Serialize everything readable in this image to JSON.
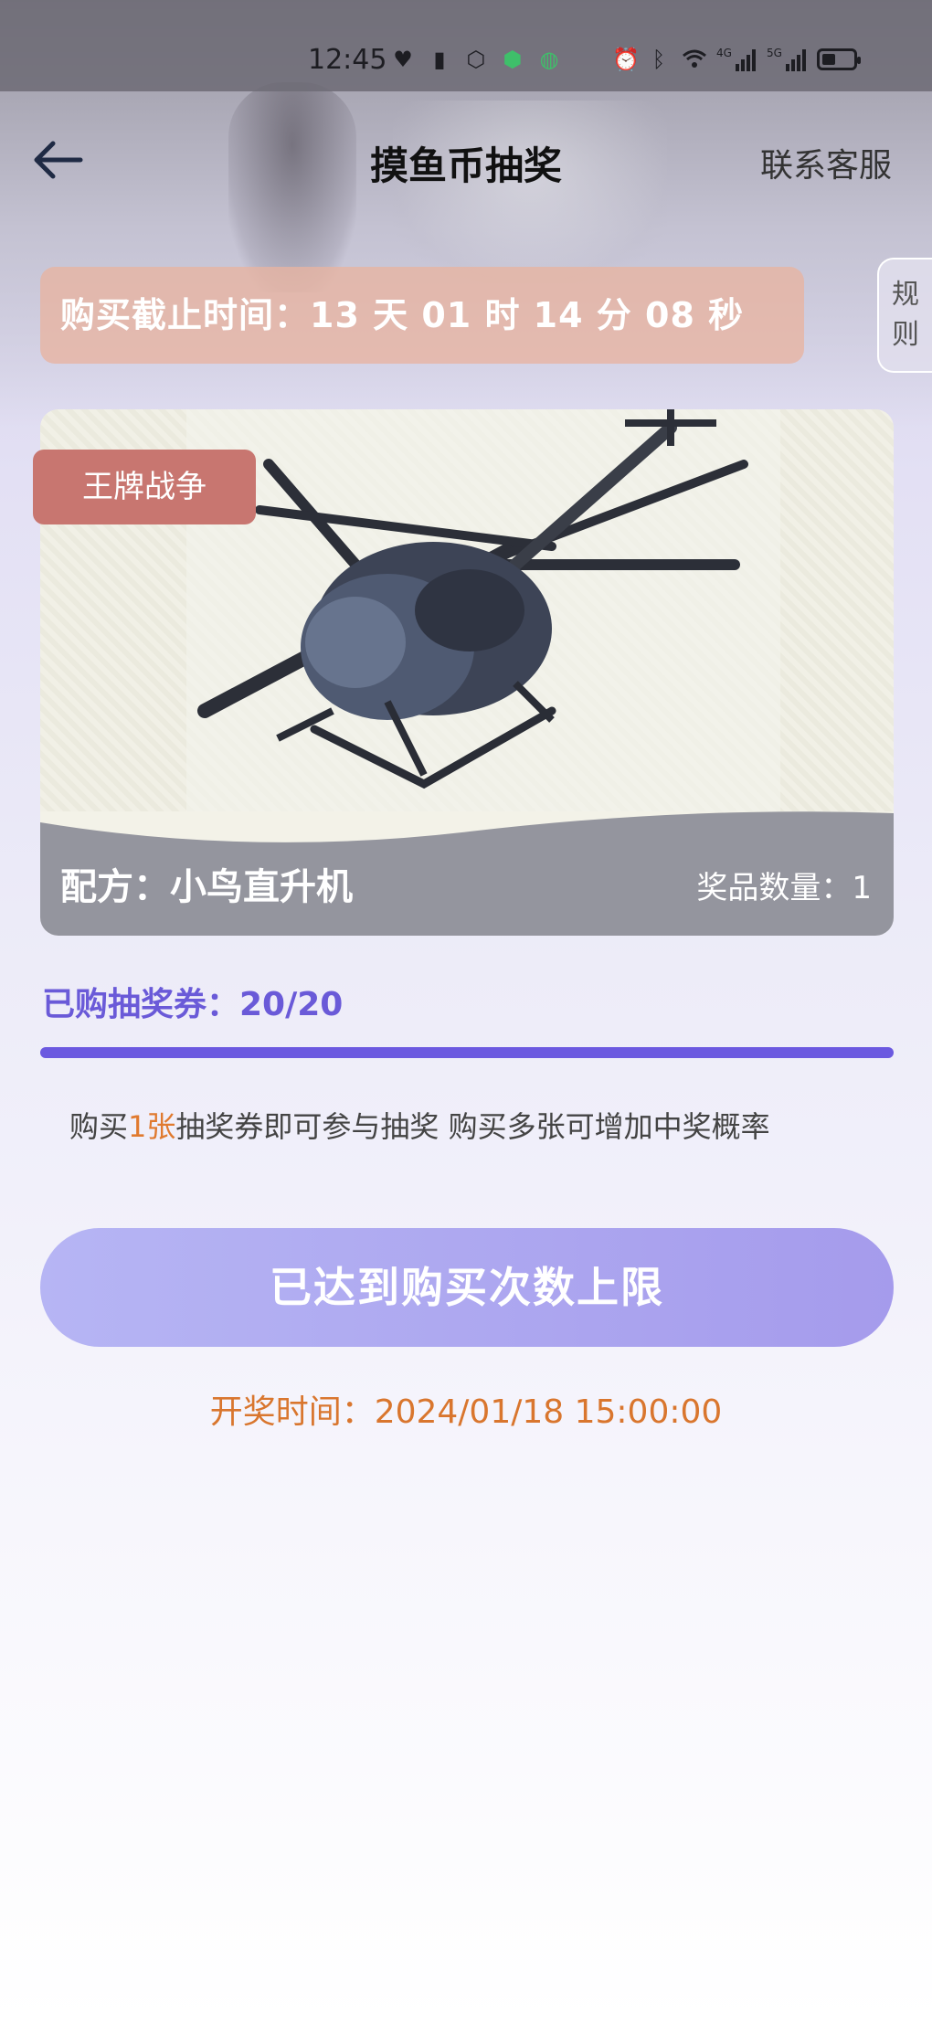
{
  "status_bar": {
    "time": "12:45",
    "left_icons": [
      "heart-icon",
      "battery-alert-icon",
      "hexagon-hand-icon",
      "shield-check-icon",
      "globe-icon"
    ],
    "right_icons": [
      "alarm-icon",
      "bluetooth-icon",
      "wifi-icon",
      "signal-4g-icon",
      "signal-5g-icon",
      "battery-icon"
    ],
    "signal_tags": [
      "4G",
      "5G"
    ]
  },
  "nav": {
    "back_icon": "back-arrow-icon",
    "title": "摸鱼币抽奖",
    "service_label": "联系客服"
  },
  "countdown": {
    "text": "购买截止时间：13 天 01 时 14 分 08 秒"
  },
  "rules_tab": {
    "char1": "规",
    "char2": "则"
  },
  "prize": {
    "tag": "王牌战争",
    "name": "配方：小鸟直升机",
    "quantity": "奖品数量：1",
    "image_icon": "helicopter-icon"
  },
  "tickets": {
    "label": "已购抽奖券：20/20",
    "bought": 20,
    "total": 20,
    "progress_percent": 100
  },
  "hint": {
    "prefix": "购买",
    "highlight": "1张",
    "suffix": "抽奖券即可参与抽奖 购买多张可增加中奖概率"
  },
  "action": {
    "button_label": "已达到购买次数上限"
  },
  "draw": {
    "time_text": "开奖时间：2024/01/18 15:00:00"
  },
  "colors": {
    "accent_purple": "#6b59e0",
    "highlight_orange": "#e07a2f",
    "tag_red": "#c87670",
    "countdown_bg": "#e8b4a0"
  }
}
